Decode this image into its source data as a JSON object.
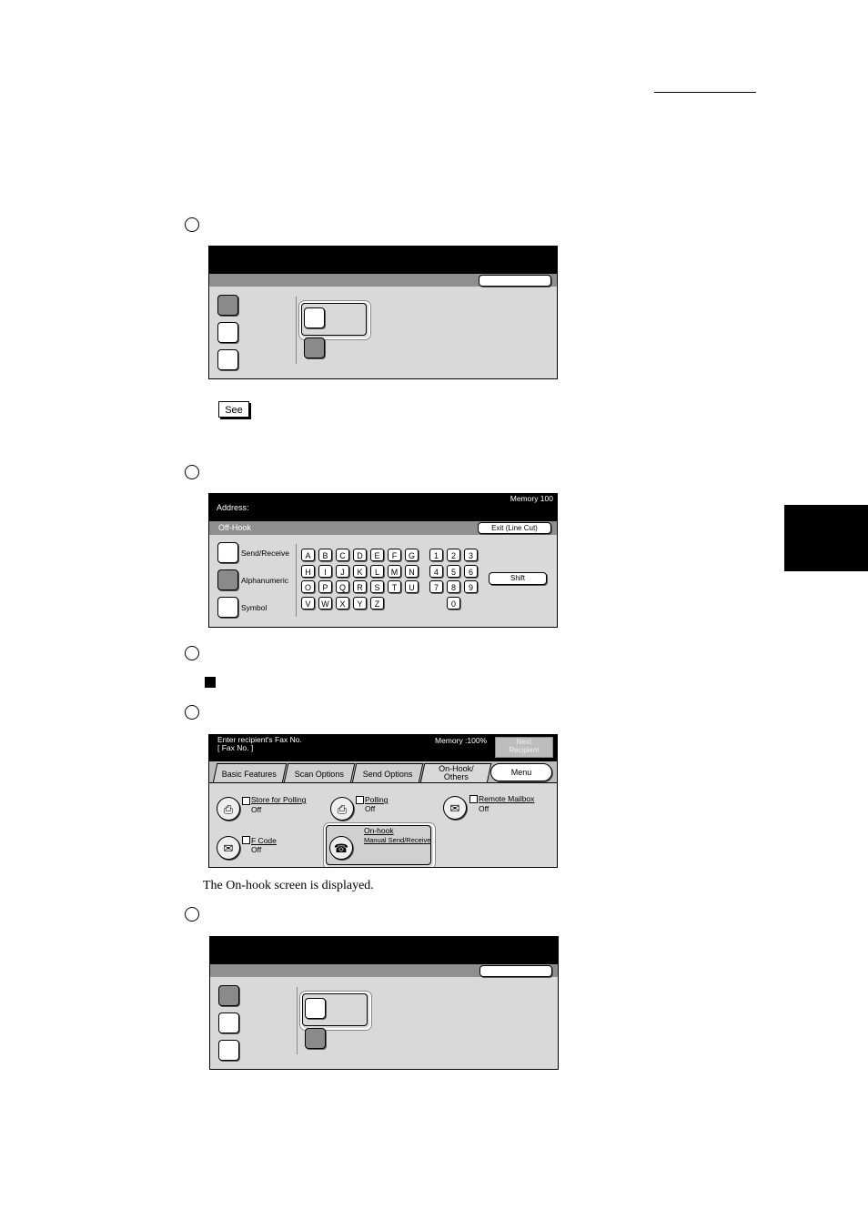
{
  "panel2": {
    "address_label": "Address:",
    "memory": "Memory 100",
    "status": "Off-Hook",
    "exit_button": "Exit (Line Cut)",
    "modes": [
      "Send/Receive",
      "Alphanumeric",
      "Symbol"
    ],
    "letter_rows": [
      [
        "A",
        "B",
        "C",
        "D",
        "E",
        "F",
        "G"
      ],
      [
        "H",
        "I",
        "J",
        "K",
        "L",
        "M",
        "N"
      ],
      [
        "O",
        "P",
        "Q",
        "R",
        "S",
        "T",
        "U"
      ],
      [
        "V",
        "W",
        "X",
        "Y",
        "Z"
      ]
    ],
    "number_rows": [
      [
        "1",
        "2",
        "3"
      ],
      [
        "4",
        "5",
        "6"
      ],
      [
        "7",
        "8",
        "9"
      ],
      [
        "0"
      ]
    ],
    "shift_button": "Shift"
  },
  "see_icon": "See",
  "panel3": {
    "prompt_line1": "Enter recipient's Fax No.",
    "prompt_line2": "[  Fax No. ]",
    "memory": "Memory :100%",
    "next_line1": "Next",
    "next_line2": "Recipient",
    "tabs": [
      "Basic Features",
      "Scan Options",
      "Send Options"
    ],
    "tab_active_line1": "On-Hook/",
    "tab_active_line2": "Others",
    "menu_button": "Menu",
    "features": {
      "store": {
        "title": "Store for Polling",
        "value": "Off"
      },
      "polling": {
        "title": "Polling",
        "value": "Off"
      },
      "remote": {
        "title": "Remote Mailbox",
        "value": "Off"
      },
      "fcode": {
        "title": "F Code",
        "value": "Off"
      },
      "onhook": {
        "title": "On-hook",
        "value": "Manual Send/Receive"
      }
    }
  },
  "caption": "The On-hook screen is displayed."
}
